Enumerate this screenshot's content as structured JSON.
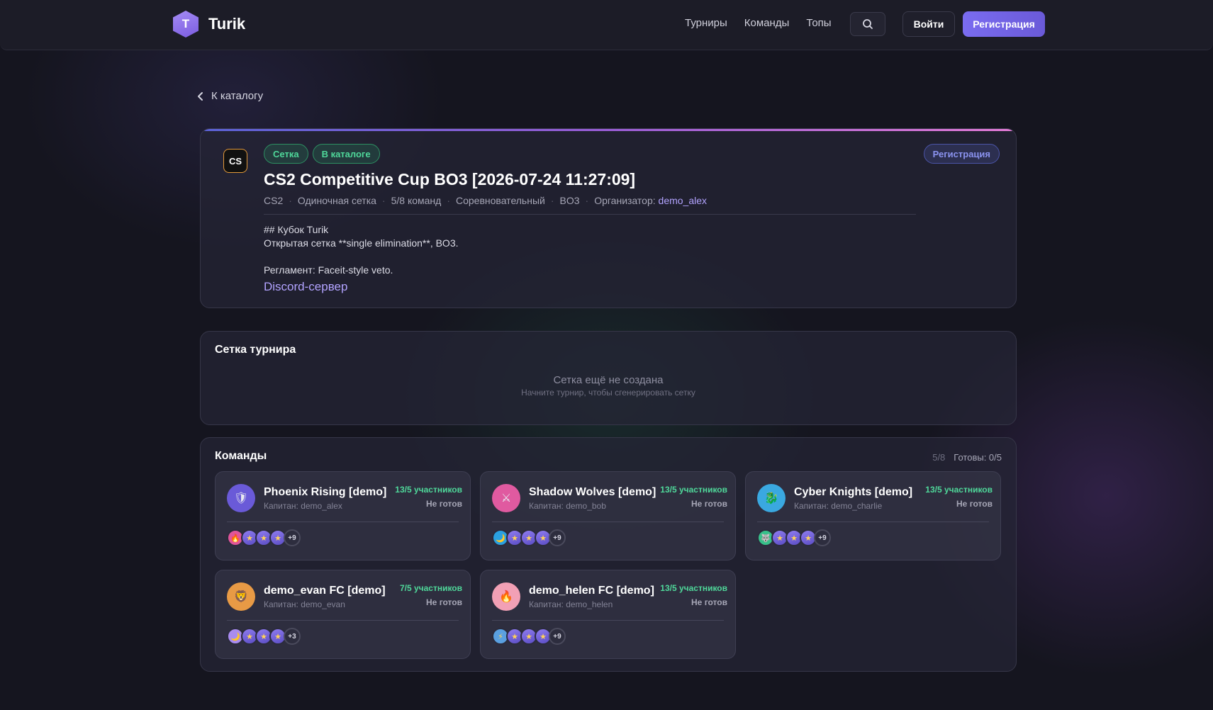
{
  "header": {
    "logo_letter": "T",
    "app_name": "Turik",
    "nav": [
      "Турниры",
      "Команды",
      "Топы"
    ],
    "login_label": "Войти",
    "register_label": "Регистрация"
  },
  "back_label": "К каталогу",
  "tournament": {
    "game_icon": "CS",
    "badges": [
      "Сетка",
      "В каталоге"
    ],
    "status_badge": "Регистрация",
    "title": "CS2 Competitive Cup BO3 [2026-07-24 11:27:09]",
    "meta": {
      "game": "CS2",
      "format": "Одиночная сетка",
      "teams": "5/8 команд",
      "mode": "Соревновательный",
      "bo": "BO3",
      "organizer_label": "Организатор:",
      "organizer": "demo_alex"
    },
    "description": [
      "## Кубок Turik",
      "Открытая сетка **single elimination**, BO3.",
      "",
      "Регламент: Faceit-style veto."
    ],
    "discord_label": "Discord-сервер"
  },
  "bracket": {
    "title": "Сетка турнира",
    "empty_title": "Сетка ещё не создана",
    "empty_sub": "Начните турнир, чтобы сгенерировать сетку"
  },
  "teams_section": {
    "title": "Команды",
    "count": "5/8",
    "ready": "Готовы: 0/5",
    "teams": [
      {
        "name": "Phoenix Rising [demo]",
        "captain": "Капитан: demo_alex",
        "members": "13/5 участников",
        "status": "Не готов",
        "avatar_icon": "shield-icon",
        "avatar_color": "#6a5ad8",
        "first_chip": "🔥",
        "more": "+9"
      },
      {
        "name": "Shadow Wolves [demo]",
        "captain": "Капитан: demo_bob",
        "members": "13/5 участников",
        "status": "Не готов",
        "avatar_icon": "swords-icon",
        "avatar_color": "#e05aa0",
        "first_chip": "🌙",
        "more": "+9"
      },
      {
        "name": "Cyber Knights [demo]",
        "captain": "Капитан: demo_charlie",
        "members": "13/5 участников",
        "status": "Не готов",
        "avatar_icon": "dragon-icon",
        "avatar_color": "#3aa8e0",
        "first_chip": "🐺",
        "more": "+9"
      },
      {
        "name": "demo_evan FC [demo]",
        "captain": "Капитан: demo_evan",
        "members": "7/5 участников",
        "status": "Не готов",
        "avatar_icon": "lion-icon",
        "avatar_color": "#e89a45",
        "first_chip": "🌙",
        "more": "+3"
      },
      {
        "name": "demo_helen FC [demo]",
        "captain": "Капитан: demo_helen",
        "members": "13/5 участников",
        "status": "Не готов",
        "avatar_icon": "fire-icon",
        "avatar_color": "#f2a0b5",
        "first_chip": "⚡",
        "more": "+9"
      }
    ]
  }
}
